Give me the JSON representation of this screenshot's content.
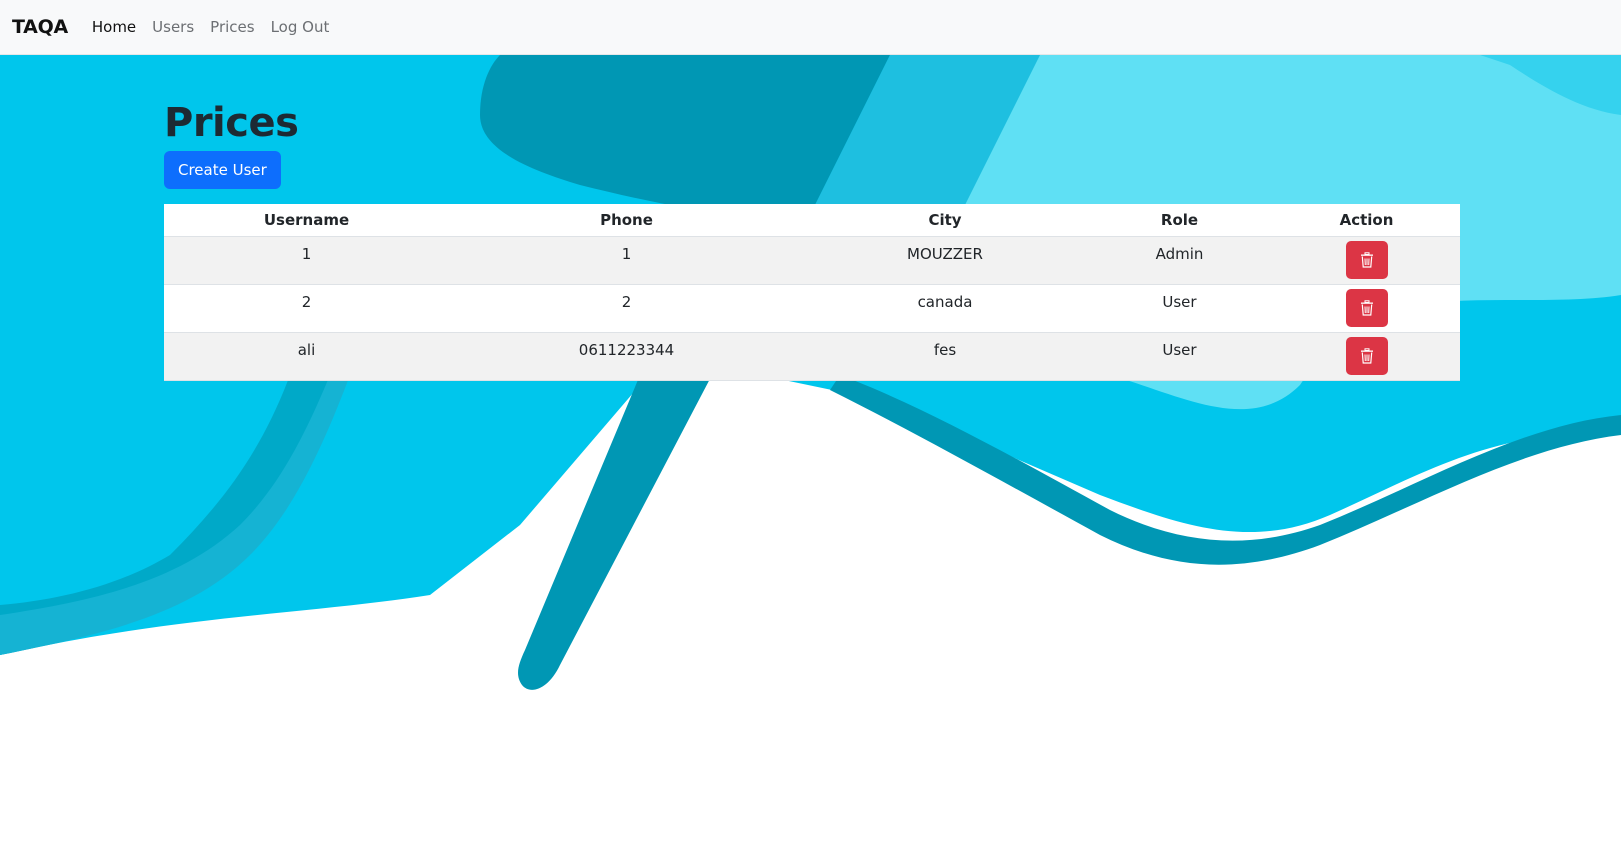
{
  "nav": {
    "brand": "TAQA",
    "links": [
      "Home",
      "Users",
      "Prices",
      "Log Out"
    ]
  },
  "page": {
    "title": "Prices",
    "create_button": "Create User"
  },
  "table": {
    "headers": [
      "Username",
      "Phone",
      "City",
      "Role",
      "Action"
    ],
    "rows": [
      [
        "1",
        "1",
        "MOUZZER",
        "Admin"
      ],
      [
        "2",
        "2",
        "canada",
        "User"
      ],
      [
        "ali",
        "0611223344",
        "fes",
        "User"
      ]
    ]
  },
  "icons": {
    "delete": "trash-icon"
  },
  "colors": {
    "primary": "#0d6efd",
    "danger": "#dc3545",
    "background_accent": "#00c6ec"
  }
}
